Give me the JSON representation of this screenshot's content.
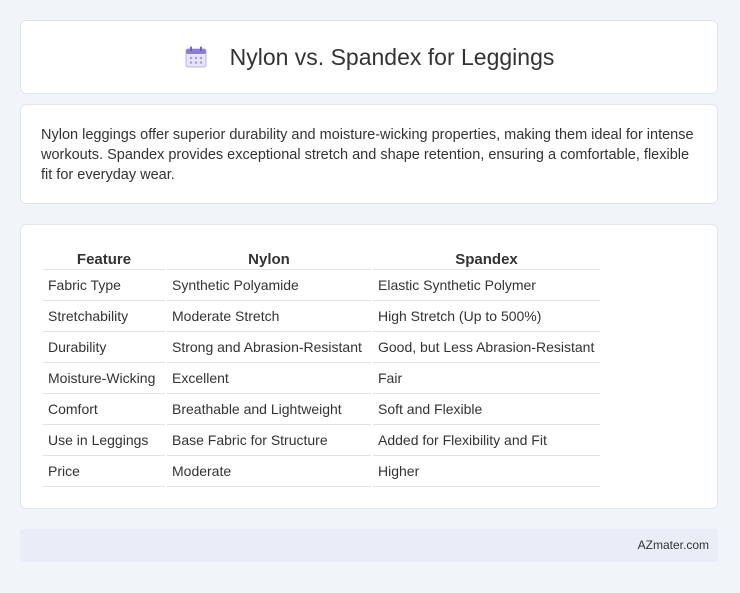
{
  "header": {
    "title": "Nylon vs. Spandex for Leggings",
    "icon": "calendar-icon",
    "icon_color": "#8a7fd8"
  },
  "summary": {
    "text": "Nylon leggings offer superior durability and moisture-wicking properties, making them ideal for intense workouts. Spandex provides exceptional stretch and shape retention, ensuring a comfortable, flexible fit for everyday wear."
  },
  "table": {
    "headers": [
      "Feature",
      "Nylon",
      "Spandex"
    ],
    "rows": [
      [
        "Fabric Type",
        "Synthetic Polyamide",
        "Elastic Synthetic Polymer"
      ],
      [
        "Stretchability",
        "Moderate Stretch",
        "High Stretch (Up to 500%)"
      ],
      [
        "Durability",
        "Strong and Abrasion-Resistant",
        "Good, but Less Abrasion-Resistant"
      ],
      [
        "Moisture-Wicking",
        "Excellent",
        "Fair"
      ],
      [
        "Comfort",
        "Breathable and Lightweight",
        "Soft and Flexible"
      ],
      [
        "Use in Leggings",
        "Base Fabric for Structure",
        "Added for Flexibility and Fit"
      ],
      [
        "Price",
        "Moderate",
        "Higher"
      ]
    ]
  },
  "footer": {
    "site": "AZmater.com"
  }
}
